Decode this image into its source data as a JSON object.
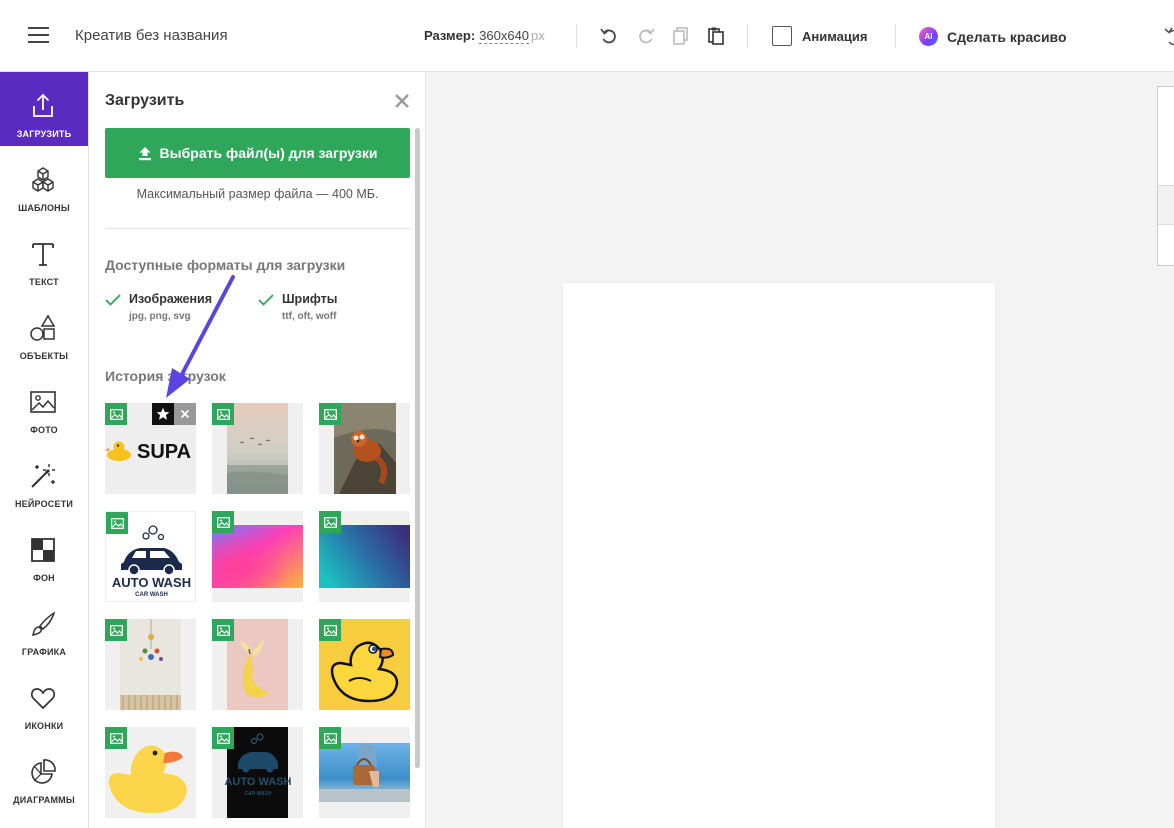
{
  "header": {
    "title": "Креатив без названия",
    "size_label": "Размер:",
    "size_value": "360x640",
    "size_unit": "px",
    "animation_label": "Анимация",
    "ai_badge": "AI",
    "beautify_label": "Сделать красиво"
  },
  "sidebar": {
    "items": [
      {
        "label": "ЗАГРУЗИТЬ",
        "icon": "upload-icon"
      },
      {
        "label": "ШАБЛОНЫ",
        "icon": "cubes-icon"
      },
      {
        "label": "ТЕКСТ",
        "icon": "text-icon"
      },
      {
        "label": "ОБЪЕКТЫ",
        "icon": "shapes-icon"
      },
      {
        "label": "ФОТО",
        "icon": "photo-icon"
      },
      {
        "label": "НЕЙРОСЕТИ",
        "icon": "magic-wand-icon"
      },
      {
        "label": "ФОН",
        "icon": "background-icon"
      },
      {
        "label": "ГРАФИКА",
        "icon": "brush-icon"
      },
      {
        "label": "ИКОНКИ",
        "icon": "heart-icon"
      },
      {
        "label": "ДИАГРАММЫ",
        "icon": "pie-chart-icon"
      }
    ]
  },
  "panel": {
    "title": "Загрузить",
    "upload_button": "Выбрать файл(ы) для загрузки",
    "max_size": "Максимальный размер файла — 400 МБ.",
    "formats_title": "Доступные форматы для загрузки",
    "formats": [
      {
        "name": "Изображения",
        "ext": "jpg, png, svg"
      },
      {
        "name": "Шрифты",
        "ext": "ttf, oft, woff"
      }
    ],
    "history_title": "История загрузок",
    "thumbnails": [
      {
        "kind": "supa-duck-logo",
        "logo_text": "SUPA"
      },
      {
        "kind": "foggy-sea-photo"
      },
      {
        "kind": "red-panda-photo"
      },
      {
        "kind": "auto-wash-logo",
        "logo_text": "AUTO WASH",
        "logo_sub": "CAR WASH"
      },
      {
        "kind": "pink-gradient"
      },
      {
        "kind": "teal-gradient"
      },
      {
        "kind": "wall-mobile-photo"
      },
      {
        "kind": "banana-photo"
      },
      {
        "kind": "duck-on-yellow"
      },
      {
        "kind": "duck-on-white"
      },
      {
        "kind": "auto-wash-dark-logo",
        "logo_text": "AUTO WASH",
        "logo_sub": "CAR WASH"
      },
      {
        "kind": "beach-bag-photo"
      }
    ]
  },
  "colors": {
    "accent": "#5b2bbf",
    "upload_green": "#2ea75a",
    "arrow": "#5b45e0"
  }
}
